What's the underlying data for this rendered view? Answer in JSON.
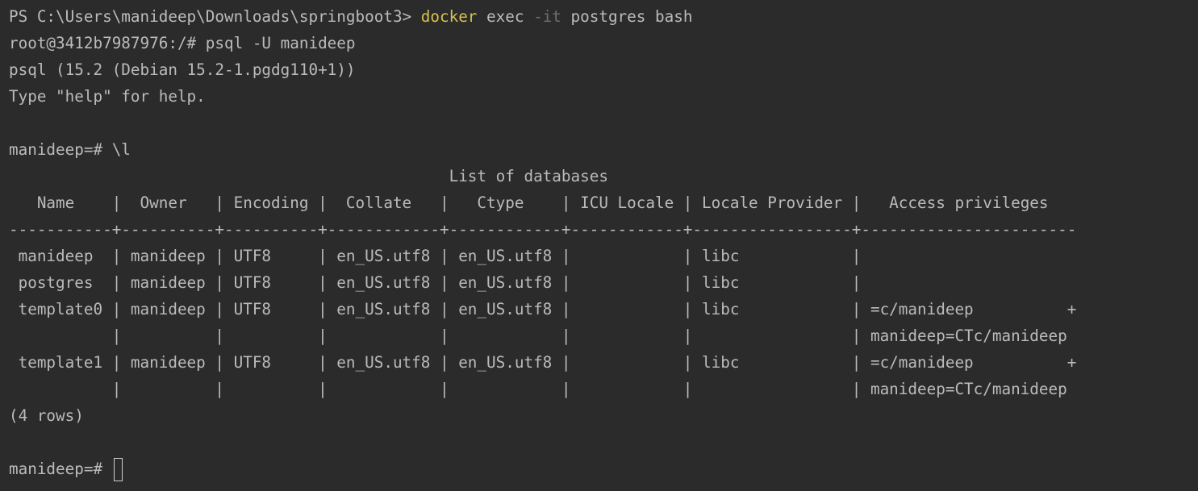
{
  "terminal": {
    "prompt_ps": "PS C:\\Users\\manideep\\Downloads\\springboot3> ",
    "cmd_docker": "docker",
    "cmd_exec": " exec ",
    "cmd_flag": "-it",
    "cmd_rest": " postgres bash",
    "line_root": "root@3412b7987976:/# psql -U manideep",
    "line_version": "psql (15.2 (Debian 15.2-1.pgdg110+1))",
    "line_help": "Type \"help\" for help.",
    "line_list_cmd": "manideep=# \\l",
    "table_title": "                                               List of databases",
    "table_header": "   Name    |  Owner   | Encoding |  Collate   |   Ctype    | ICU Locale | Locale Provider |   Access privileges",
    "table_separator": "-----------+----------+----------+------------+------------+------------+-----------------+-----------------------",
    "rows": [
      " manideep  | manideep | UTF8     | en_US.utf8 | en_US.utf8 |            | libc            |",
      " postgres  | manideep | UTF8     | en_US.utf8 | en_US.utf8 |            | libc            |",
      " template0 | manideep | UTF8     | en_US.utf8 | en_US.utf8 |            | libc            | =c/manideep          +",
      "           |          |          |            |            |            |                 | manideep=CTc/manideep",
      " template1 | manideep | UTF8     | en_US.utf8 | en_US.utf8 |            | libc            | =c/manideep          +",
      "           |          |          |            |            |            |                 | manideep=CTc/manideep"
    ],
    "row_count": "(4 rows)",
    "final_prompt": "manideep=# "
  }
}
